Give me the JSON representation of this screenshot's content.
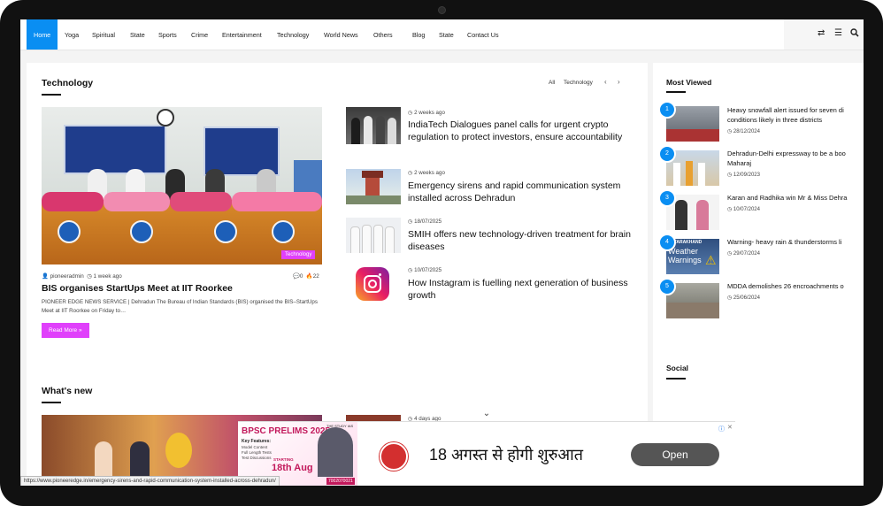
{
  "nav": {
    "items": [
      "Home",
      "Yoga",
      "Spiritual",
      "State",
      "Sports",
      "Crime",
      "Entertainment",
      "Technology",
      "World News",
      "Others",
      "Blog",
      "State",
      "Contact Us"
    ]
  },
  "technology": {
    "title": "Technology",
    "filter_all": "All",
    "filter_tech": "Technology",
    "featured": {
      "tag": "Technology",
      "author": "pioneeradmin",
      "time": "1 week ago",
      "comments": "0",
      "views": "22",
      "title": "BIS organises StartUps Meet at IIT Roorkee",
      "excerpt": "PIONEER EDGE NEWS SERVICE | Dehradun The Bureau of Indian Standards (BIS) organised the BIS–StartUps Meet at IIT Roorkee on Friday to…",
      "read_more": "Read More »"
    },
    "list": [
      {
        "date": "2 weeks ago",
        "title": "IndiaTech Dialogues panel calls for urgent crypto regulation to protect investors, ensure accountability"
      },
      {
        "date": "2 weeks ago",
        "title": "Emergency sirens and rapid communication system installed across Dehradun"
      },
      {
        "date": "18/07/2025",
        "title": "SMIH offers new technology-driven treatment for brain diseases"
      },
      {
        "date": "10/07/2025",
        "title": "How Instagram is fuelling next generation of business growth"
      }
    ]
  },
  "whats_new": {
    "title": "What's new",
    "peek_date": "4 days ago"
  },
  "most_viewed": {
    "title": "Most Viewed",
    "items": [
      {
        "num": "1",
        "title": "Heavy snowfall alert issued for seven di",
        "title2": "conditions likely in three districts",
        "date": "28/12/2024"
      },
      {
        "num": "2",
        "title": "Dehradun-Delhi expressway to be a boo",
        "title2": "Maharaj",
        "date": "12/09/2023"
      },
      {
        "num": "3",
        "title": "Karan and Radhika win Mr & Miss Dehra",
        "title2": "",
        "date": "10/07/2024"
      },
      {
        "num": "4",
        "title": "Warning- heavy rain & thunderstorms li",
        "title2": "",
        "date": "29/07/2024"
      },
      {
        "num": "5",
        "title": "MDDA demolishes 26 encroachments o",
        "title2": "",
        "date": "25/06/2024"
      }
    ],
    "thumb4_text1": "UTTARAKHAND",
    "thumb4_text2": "Weather",
    "thumb4_text3": "Warnings"
  },
  "social": {
    "title": "Social"
  },
  "ad": {
    "headline": "BPSC PRELIMS 2025",
    "features_label": "Key Features:",
    "f1": "Model Content",
    "f2": "Full Length Tests",
    "f3": "Test Discussions",
    "starting": "STARTING",
    "date": "18th Aug",
    "brand": "THE STUDY IAS",
    "phone": "7002070021",
    "hindi": "18 अगस्त से होगी शुरुआत",
    "open": "Open"
  },
  "status_url": "https://www.pioneeredge.in/emergency-sirens-and-rapid-communication-system-installed-across-dehradun/"
}
